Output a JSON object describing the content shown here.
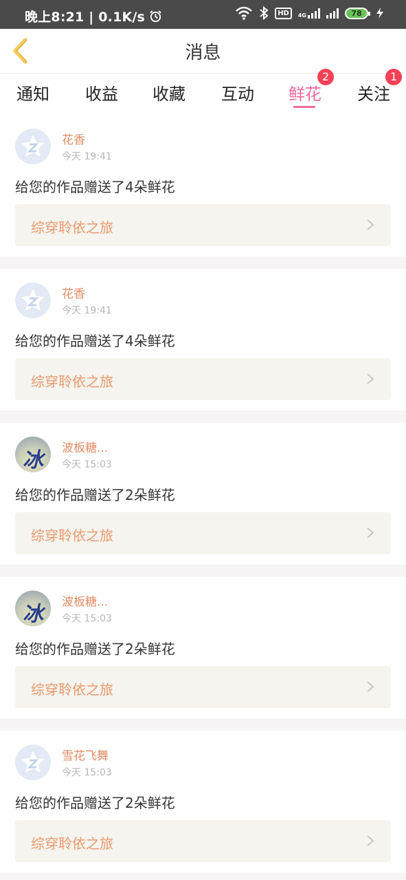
{
  "status_bar": {
    "time_speed": "晚上8:21 | 0.1K/s",
    "hd": "HD",
    "network": "4G",
    "battery": "78"
  },
  "header": {
    "title": "消息",
    "back_icon": "chevron-left-icon"
  },
  "tabs": [
    {
      "label": "通知",
      "active": false
    },
    {
      "label": "收益",
      "active": false
    },
    {
      "label": "收藏",
      "active": false
    },
    {
      "label": "互动",
      "active": false
    },
    {
      "label": "鲜花",
      "active": true,
      "badge": "2"
    },
    {
      "label": "关注",
      "active": false,
      "badge": "1"
    }
  ],
  "colors": {
    "accent": "#ef6aa0",
    "badge": "#f54057",
    "username": "#e28b62",
    "work_title": "#e79a6e"
  },
  "messages": [
    {
      "user": "花香",
      "time": "今天 19:41",
      "text": "给您的作品赠送了4朵鲜花",
      "work": "综穿聆依之旅",
      "avatar": "default-avatar-icon"
    },
    {
      "user": "花香",
      "time": "今天 19:41",
      "text": "给您的作品赠送了4朵鲜花",
      "work": "综穿聆依之旅",
      "avatar": "default-avatar-icon"
    },
    {
      "user": "波板糖...",
      "time": "今天 15:03",
      "text": "给您的作品赠送了2朵鲜花",
      "work": "综穿聆依之旅",
      "avatar": "photo-avatar",
      "avatar_text": "冰"
    },
    {
      "user": "波板糖...",
      "time": "今天 15:03",
      "text": "给您的作品赠送了2朵鲜花",
      "work": "综穿聆依之旅",
      "avatar": "photo-avatar",
      "avatar_text": "冰"
    },
    {
      "user": "雪花飞舞",
      "time": "今天 15:03",
      "text": "给您的作品赠送了2朵鲜花",
      "work": "综穿聆依之旅",
      "avatar": "default-avatar-icon"
    }
  ]
}
